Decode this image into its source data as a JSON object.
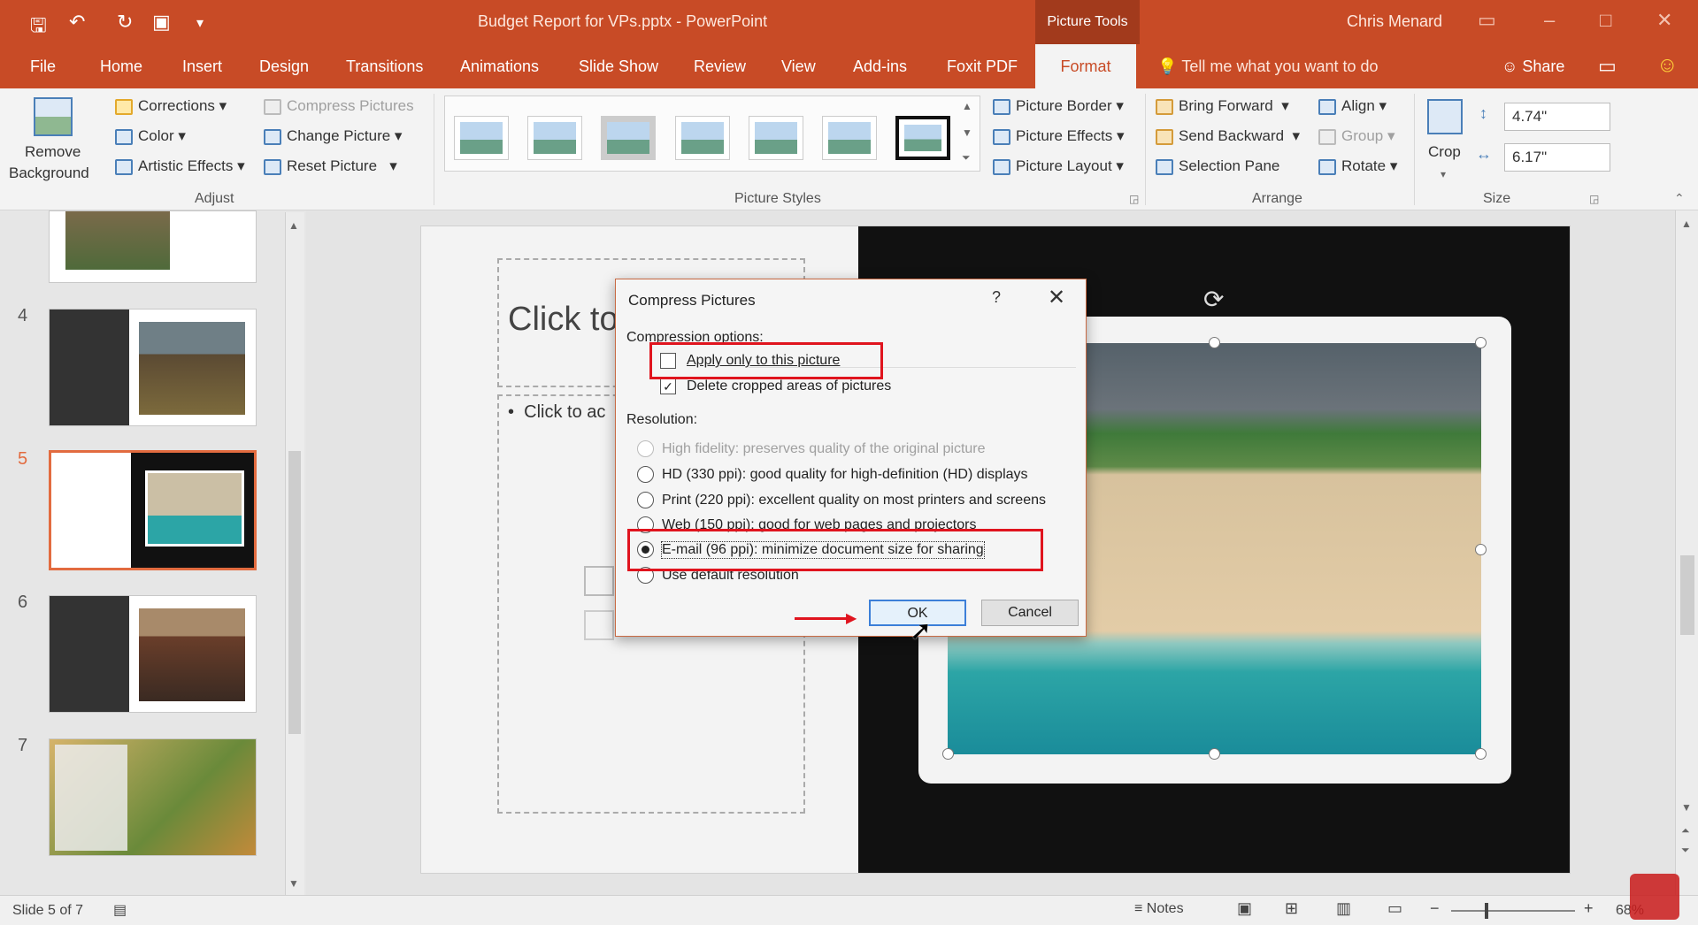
{
  "titlebar": {
    "doc_title": "Budget Report for VPs.pptx  -  PowerPoint",
    "context_tab": "Picture Tools",
    "user": "Chris Menard"
  },
  "tabs": {
    "file": "File",
    "home": "Home",
    "insert": "Insert",
    "design": "Design",
    "transitions": "Transitions",
    "animations": "Animations",
    "slideshow": "Slide Show",
    "review": "Review",
    "view": "View",
    "addins": "Add-ins",
    "foxit": "Foxit PDF",
    "format": "Format",
    "tell_me": "Tell me what you want to do",
    "share": "Share"
  },
  "ribbon": {
    "remove_bg_1": "Remove",
    "remove_bg_2": "Background",
    "corrections": "Corrections",
    "color": "Color",
    "artistic": "Artistic Effects",
    "compress": "Compress Pictures",
    "change": "Change Picture",
    "reset": "Reset Picture",
    "adjust_label": "Adjust",
    "styles_label": "Picture Styles",
    "picture_border": "Picture Border",
    "picture_effects": "Picture Effects",
    "picture_layout": "Picture Layout",
    "bring_forward": "Bring Forward",
    "send_backward": "Send Backward",
    "selection_pane": "Selection Pane",
    "align": "Align",
    "group": "Group",
    "rotate": "Rotate",
    "arrange_label": "Arrange",
    "crop": "Crop",
    "height": "4.74\"",
    "width": "6.17\"",
    "size_label": "Size"
  },
  "slides": {
    "numbers": [
      "4",
      "5",
      "6",
      "7"
    ]
  },
  "slide": {
    "title": "Click to",
    "content": "Click to ac"
  },
  "dialog": {
    "title": "Compress Pictures",
    "help": "?",
    "close": "✕",
    "compression_options": "Compression options:",
    "apply_only": "Apply only to this picture",
    "delete_cropped": "Delete cropped areas of pictures",
    "resolution": "Resolution:",
    "high_fidelity": "High fidelity: preserves quality of the original picture",
    "hd": "HD (330 ppi): good quality for high-definition (HD) displays",
    "print": "Print (220 ppi): excellent quality on most printers and screens",
    "web": "Web (150 ppi): good for web pages and projectors",
    "email": "E-mail (96 ppi): minimize document size for sharing",
    "default_res": "Use default resolution",
    "ok": "OK",
    "cancel": "Cancel"
  },
  "status": {
    "slide_count": "Slide 5 of 7",
    "notes": "Notes",
    "zoom": "68%"
  },
  "colors": {
    "accent": "#c84b26",
    "highlight": "#e0141e"
  }
}
